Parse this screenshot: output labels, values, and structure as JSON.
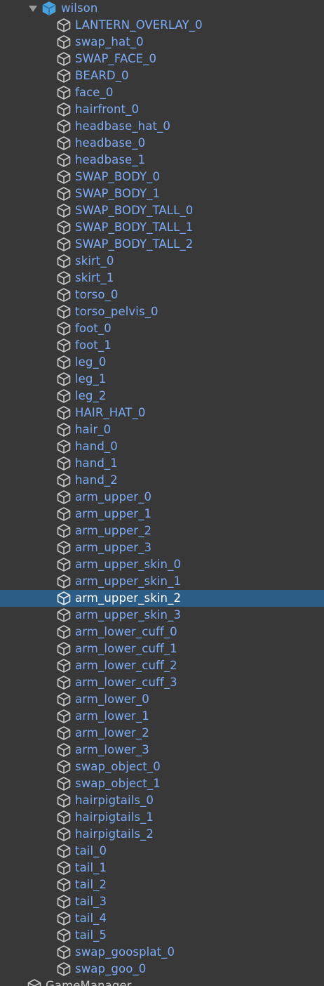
{
  "root": {
    "label": "wilson",
    "expanded": true,
    "icon": "prefab-cube-icon"
  },
  "children": [
    "LANTERN_OVERLAY_0",
    "swap_hat_0",
    "SWAP_FACE_0",
    "BEARD_0",
    "face_0",
    "hairfront_0",
    "headbase_hat_0",
    "headbase_0",
    "headbase_1",
    "SWAP_BODY_0",
    "SWAP_BODY_1",
    "SWAP_BODY_TALL_0",
    "SWAP_BODY_TALL_1",
    "SWAP_BODY_TALL_2",
    "skirt_0",
    "skirt_1",
    "torso_0",
    "torso_pelvis_0",
    "foot_0",
    "foot_1",
    "leg_0",
    "leg_1",
    "leg_2",
    "HAIR_HAT_0",
    "hair_0",
    "hand_0",
    "hand_1",
    "hand_2",
    "arm_upper_0",
    "arm_upper_1",
    "arm_upper_2",
    "arm_upper_3",
    "arm_upper_skin_0",
    "arm_upper_skin_1",
    "arm_upper_skin_2",
    "arm_upper_skin_3",
    "arm_lower_cuff_0",
    "arm_lower_cuff_1",
    "arm_lower_cuff_2",
    "arm_lower_cuff_3",
    "arm_lower_0",
    "arm_lower_1",
    "arm_lower_2",
    "arm_lower_3",
    "swap_object_0",
    "swap_object_1",
    "hairpigtails_0",
    "hairpigtails_1",
    "hairpigtails_2",
    "tail_0",
    "tail_1",
    "tail_2",
    "tail_3",
    "tail_4",
    "tail_5",
    "swap_goosplat_0",
    "swap_goo_0"
  ],
  "selected_child": "arm_upper_skin_2",
  "next_root": {
    "label": "GameManager",
    "icon": "gameobject-cube-icon"
  },
  "colors": {
    "background": "#383838",
    "prefab_text": "#7cabf5",
    "selection": "#2c5d87",
    "plain_text": "#c9c9c9"
  }
}
